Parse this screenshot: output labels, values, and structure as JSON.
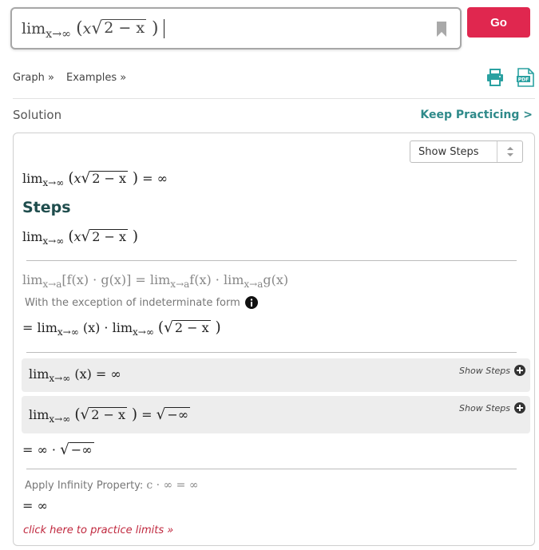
{
  "search": {
    "lim": "lim",
    "sub": "x→∞",
    "x": "x",
    "radicand": "2 − x"
  },
  "header": {
    "go_label": "Go",
    "graph_label": "Graph »",
    "examples_label": "Examples »",
    "print_icon": "print-icon",
    "pdf_icon": "pdf-icon",
    "bookmark_icon": "bookmark-icon"
  },
  "solution": {
    "label": "Solution",
    "keep_practicing": "Keep Practicing >",
    "show_steps_select": "Show Steps",
    "answer": {
      "lim": "lim",
      "sub": "x→∞",
      "x": "x",
      "radicand": "2 − x",
      "result": "= ∞"
    },
    "steps_heading": "Steps",
    "step_expr": {
      "lim": "lim",
      "sub": "x→∞",
      "x": "x",
      "radicand": "2 − x"
    },
    "rule": {
      "lim": "lim",
      "sub": "x→a",
      "body": "[f(x) · g(x)] = ",
      "lim2": "lim",
      "sub2": "x→a",
      "f": "f(x) · ",
      "lim3": "lim",
      "sub3": "x→a",
      "g": "g(x)"
    },
    "exception_note": "With the exception of indeterminate form",
    "split": {
      "eq": "= ",
      "lim": "lim",
      "sub": "x→∞",
      "x": "(x) · ",
      "lim2": "lim",
      "sub2": "x→∞",
      "radicand": "2 − x"
    },
    "sub_step_1": {
      "lim": "lim",
      "sub": "x→∞",
      "body": "(x) = ∞",
      "show_steps": "Show Steps"
    },
    "sub_step_2": {
      "lim": "lim",
      "sub": "x→∞",
      "radicand": "2 − x",
      "eq": "=",
      "radicand2": "−∞",
      "show_steps": "Show Steps"
    },
    "product": {
      "eq": "= ∞ · ",
      "radicand": "−∞"
    },
    "infinity_property": {
      "text": "Apply Infinity Property: ",
      "formula": "c · ∞ = ∞"
    },
    "final": "= ∞",
    "practice_link": "click here to practice limits »"
  },
  "colors": {
    "go": "#e0274f",
    "keep_practicing": "#2f8a8a",
    "steps_heading": "#1f4d4d",
    "practice_link": "#c0283e",
    "icon_teal": "#2aa1a1"
  }
}
